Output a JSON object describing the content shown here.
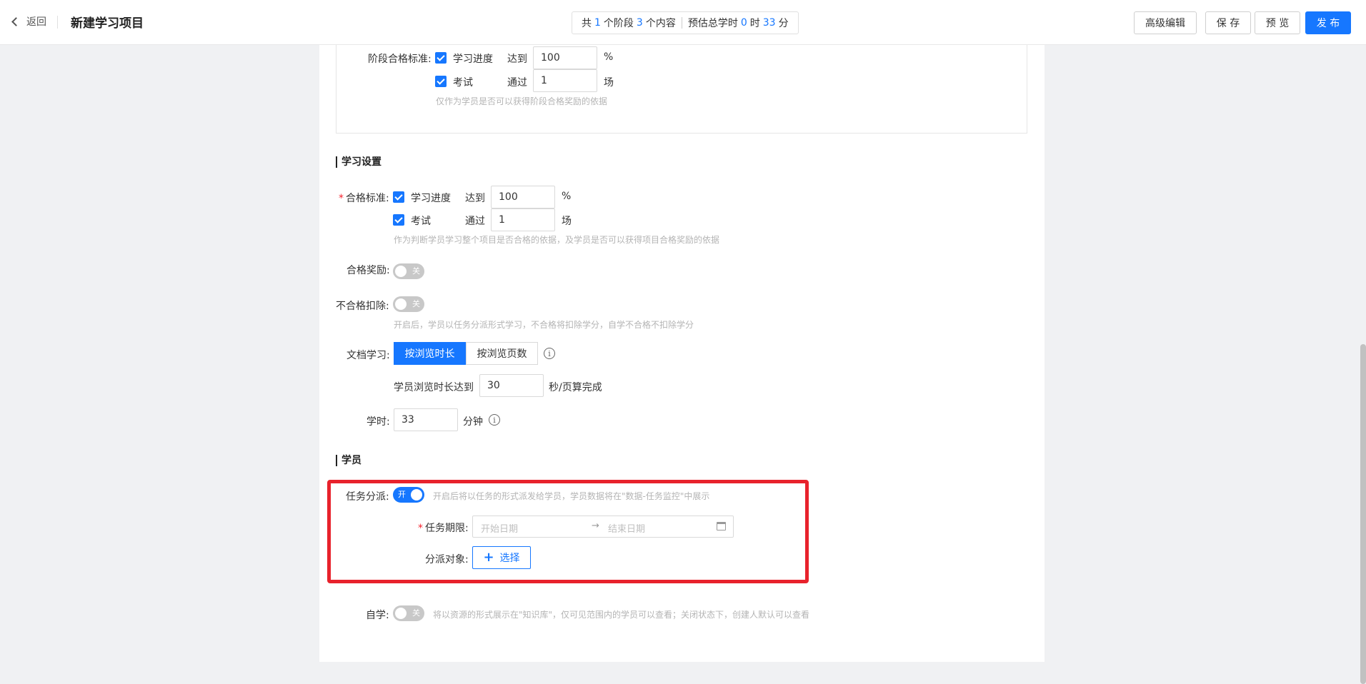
{
  "header": {
    "back_label": "返回",
    "title": "新建学习项目",
    "summary": {
      "prefix": "共",
      "stages": "1",
      "stages_text": "个阶段",
      "contents": "3",
      "contents_text": "个内容",
      "est_label": "预估总学时",
      "hours": "0",
      "hours_text": "时",
      "minutes": "33",
      "minutes_text": "分"
    },
    "buttons": {
      "advanced_edit": "高级编辑",
      "save": "保 存",
      "preview": "预 览",
      "publish": "发 布"
    }
  },
  "stage_pass": {
    "label": "阶段合格标准:",
    "progress_label": "学习进度",
    "reach_label": "达到",
    "progress_value": "100",
    "progress_unit": "%",
    "exam_label": "考试",
    "pass_label": "通过",
    "exam_value": "1",
    "exam_unit": "场",
    "hint": "仅作为学员是否可以获得阶段合格奖励的依据"
  },
  "study_settings": {
    "section_title": "学习设置",
    "pass_label": "合格标准:",
    "progress_label": "学习进度",
    "reach_label": "达到",
    "progress_value": "100",
    "progress_unit": "%",
    "exam_label": "考试",
    "pass_word": "通过",
    "exam_value": "1",
    "exam_unit": "场",
    "pass_hint": "作为判断学员学习整个项目是否合格的依据，及学员是否可以获得项目合格奖励的依据",
    "reward_label": "合格奖励:",
    "reward_toggle": "关",
    "deduct_label": "不合格扣除:",
    "deduct_toggle": "关",
    "deduct_hint": "开启后，学员以任务分派形式学习，不合格将扣除学分，自学不合格不扣除学分",
    "doc_label": "文档学习:",
    "doc_opt_time": "按浏览时长",
    "doc_opt_pages": "按浏览页数",
    "browse_label": "学员浏览时长达到",
    "browse_value": "30",
    "browse_unit": "秒/页算完成",
    "hours_label": "学时:",
    "hours_value": "33",
    "hours_unit": "分钟"
  },
  "students": {
    "section_title": "学员",
    "assign_label": "任务分派:",
    "assign_toggle": "开",
    "assign_hint": "开启后将以任务的形式派发给学员，学员数据将在\"数据-任务监控\"中展示",
    "period_label": "任务期限:",
    "start_placeholder": "开始日期",
    "end_placeholder": "结束日期",
    "arrow": "→",
    "target_label": "分派对象:",
    "select_label": "选择",
    "self_label": "自学:",
    "self_toggle": "关",
    "self_hint": "将以资源的形式展示在\"知识库\"，仅可见范围内的学员可以查看；关闭状态下，创建人默认可以查看"
  },
  "colors": {
    "primary": "#1677ff",
    "highlight": "#e8222c",
    "required": "#f5222d"
  }
}
